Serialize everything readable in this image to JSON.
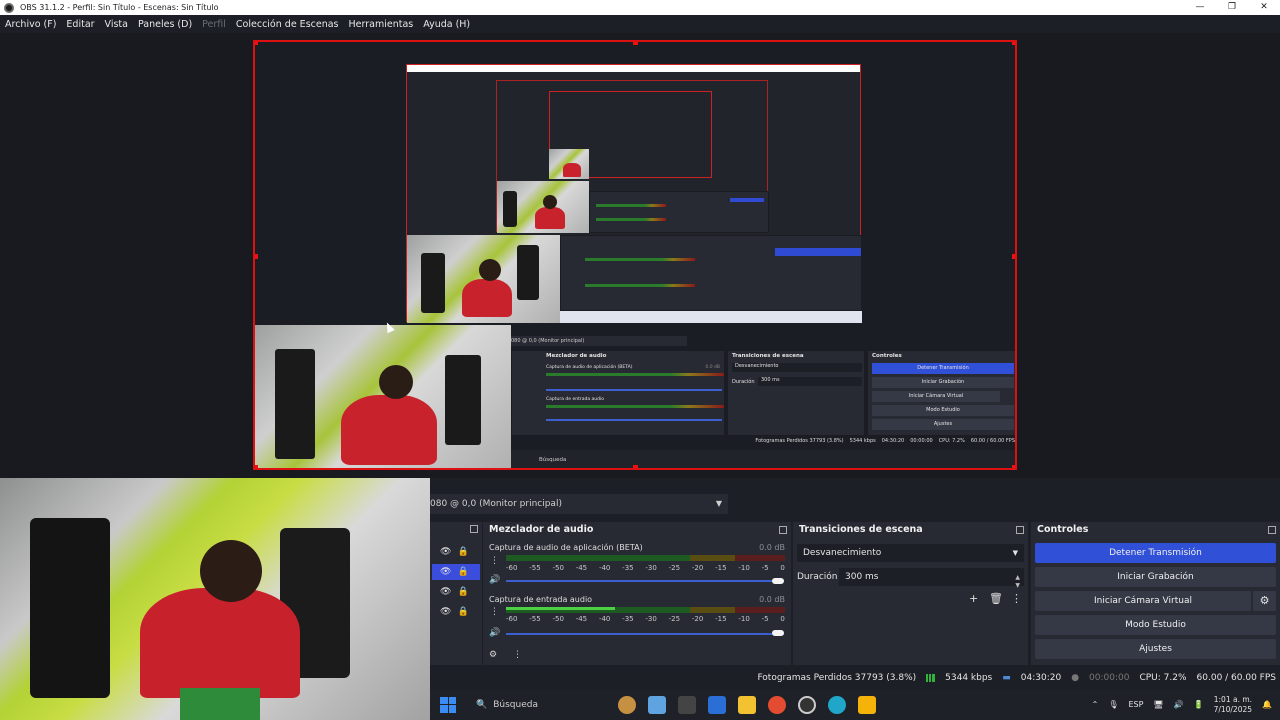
{
  "window": {
    "title": "OBS 31.1.2 - Perfil: Sin Título - Escenas: Sin Título",
    "controls": [
      "—",
      "❐",
      "✕"
    ]
  },
  "menu": [
    {
      "label": "Archivo (F)",
      "enabled": true
    },
    {
      "label": "Editar",
      "enabled": true
    },
    {
      "label": "Vista",
      "enabled": true
    },
    {
      "label": "Paneles (D)",
      "enabled": true
    },
    {
      "label": "Perfil",
      "enabled": false
    },
    {
      "label": "Colección de Escenas",
      "enabled": true
    },
    {
      "label": "Herramientas",
      "enabled": true
    },
    {
      "label": "Ayuda (H)",
      "enabled": true
    }
  ],
  "preview": {
    "nested_monitor_label": "080 @ 0,0 (Monitor principal)",
    "nested_mixer_title": "Mezclador de audio",
    "nested_transitions_title": "Transiciones de escena",
    "nested_controls_title": "Controles",
    "nested_stream_button": "Detener Transmisión",
    "nested_record_button": "Iniciar Grabación",
    "nested_virtualcam_button": "Iniciar Cámara Virtual",
    "nested_studio_button": "Modo Estudio",
    "nested_settings_button": "Ajustes",
    "nested_transition": "Desvanecimiento",
    "nested_duration_label": "Duración",
    "nested_duration": "300 ms",
    "nested_chan1": "Captura de audio de aplicación (BETA)",
    "nested_chan2": "Captura de entrada audio",
    "nested_db": "0.0 dB",
    "nested_status": "Fotogramas Perdidos 37793 (3.8%)",
    "nested_kbps": "5344 kbps",
    "nested_time": "04:30:20",
    "nested_zero": "00:00:00",
    "nested_cpu": "CPU: 7.2%",
    "nested_fps": "60.00 / 60.00 FPS",
    "nested_search": "Búsqueda"
  },
  "monitor_select": {
    "value": "080 @ 0,0 (Monitor principal)"
  },
  "sources": {
    "rows": [
      {
        "visible": true,
        "locked": true,
        "active": false
      },
      {
        "visible": true,
        "locked": true,
        "active": true
      },
      {
        "visible": true,
        "locked": true,
        "active": false
      },
      {
        "visible": true,
        "locked": true,
        "active": false
      }
    ]
  },
  "mixer": {
    "title": "Mezclador de audio",
    "channels": [
      {
        "name": "Captura de audio de aplicación (BETA)",
        "db": "0.0 dB",
        "level": 0.0,
        "volume": 1.0
      },
      {
        "name": "Captura de entrada audio",
        "db": "0.0 dB",
        "level": 0.39,
        "volume": 1.0
      }
    ],
    "scale": [
      "-60",
      "-55",
      "-50",
      "-45",
      "-40",
      "-35",
      "-30",
      "-25",
      "-20",
      "-15",
      "-10",
      "-5",
      "0"
    ]
  },
  "transitions": {
    "title": "Transiciones de escena",
    "selected": "Desvanecimiento",
    "duration_label": "Duración",
    "duration_value": "300 ms"
  },
  "controls": {
    "title": "Controles",
    "stream_button": "Detener Transmisión",
    "record_button": "Iniciar Grabación",
    "virtualcam_button": "Iniciar Cámara Virtual",
    "studio_button": "Modo Estudio",
    "settings_button": "Ajustes"
  },
  "status": {
    "dropped_frames": "Fotogramas Perdidos 37793 (3.8%)",
    "bitrate": "5344 kbps",
    "stream_time": "04:30:20",
    "record_time": "00:00:00",
    "cpu": "CPU: 7.2%",
    "fps": "60.00 / 60.00 FPS"
  },
  "taskbar": {
    "search_placeholder": "Búsqueda",
    "language": "ESP",
    "time": "1:01 a. m.",
    "date": "7/10/2025"
  },
  "colors": {
    "accent": "#3150d8",
    "selection_border": "#dd1111",
    "background": "#1d1f26",
    "panel": "#272a33"
  }
}
